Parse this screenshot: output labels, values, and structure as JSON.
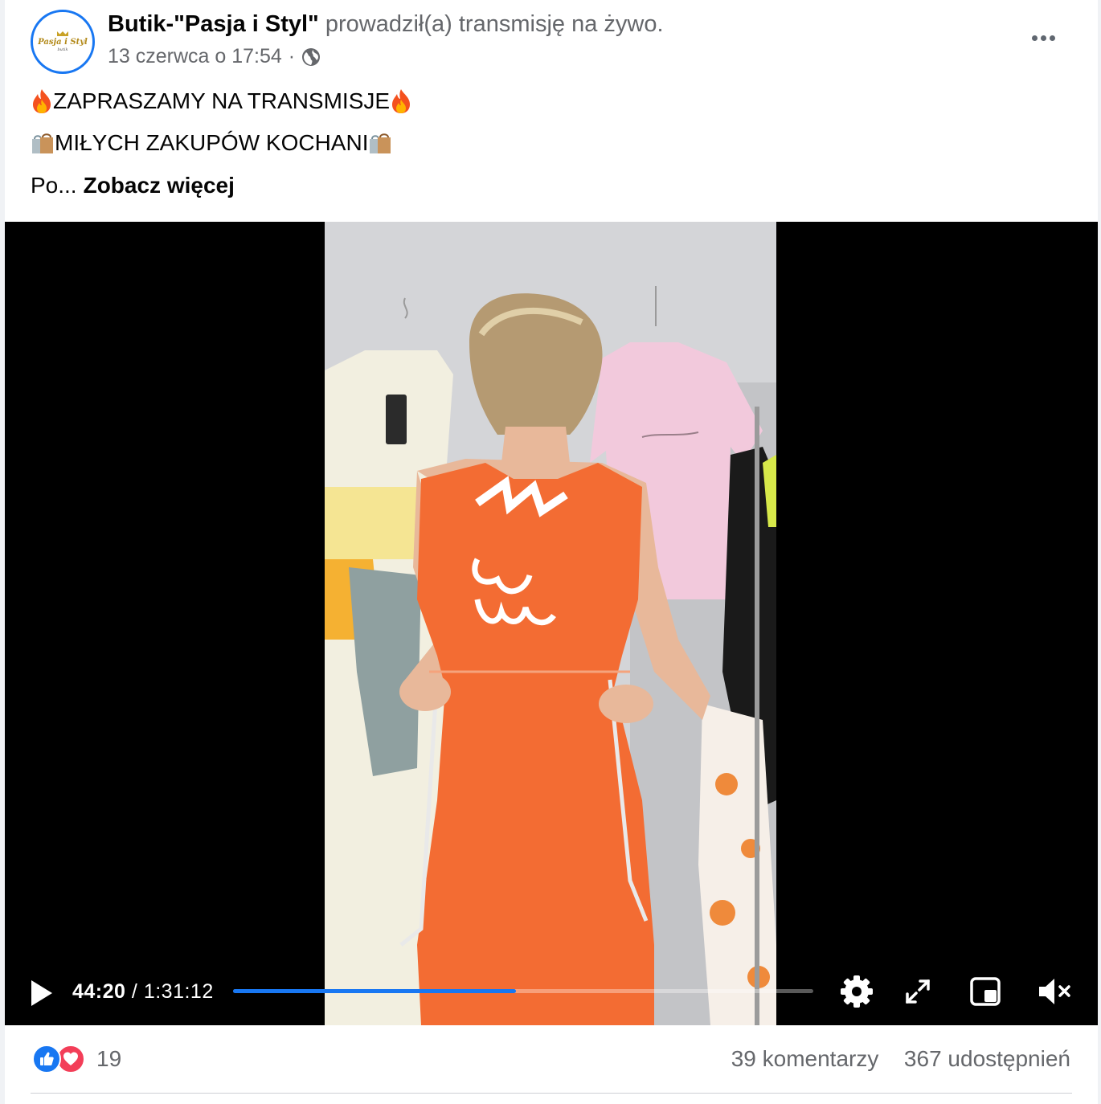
{
  "post": {
    "page_name": "Butik-\"Pasja i Styl\"",
    "action": "prowadził(a) transmisję na żywo.",
    "date": "13 czerwca o 17:54",
    "date_separator": "·",
    "privacy_icon": "globe-icon",
    "avatar": {
      "logo_text": "Pasja i Styl",
      "logo_sub": "butik"
    }
  },
  "caption": {
    "line1": "ZAPRASZAMY NA TRANSMISJE",
    "line2": "MIŁYCH ZAKUPÓW KOCHANI",
    "line3_prefix": "Po...",
    "see_more": "Zobacz więcej"
  },
  "video": {
    "current_time": "44:20",
    "separator": "/",
    "duration": "1:31:12",
    "progress": 0.488,
    "accent_color": "#1877f2",
    "controls": [
      "play-icon",
      "settings-icon",
      "fullscreen-icon",
      "miniplayer-icon",
      "muted-speaker-icon"
    ]
  },
  "footer": {
    "reaction_icons": [
      "like-icon",
      "love-icon"
    ],
    "reaction_count": "19",
    "comments": "39 komentarzy",
    "shares": "367 udostępnień"
  }
}
